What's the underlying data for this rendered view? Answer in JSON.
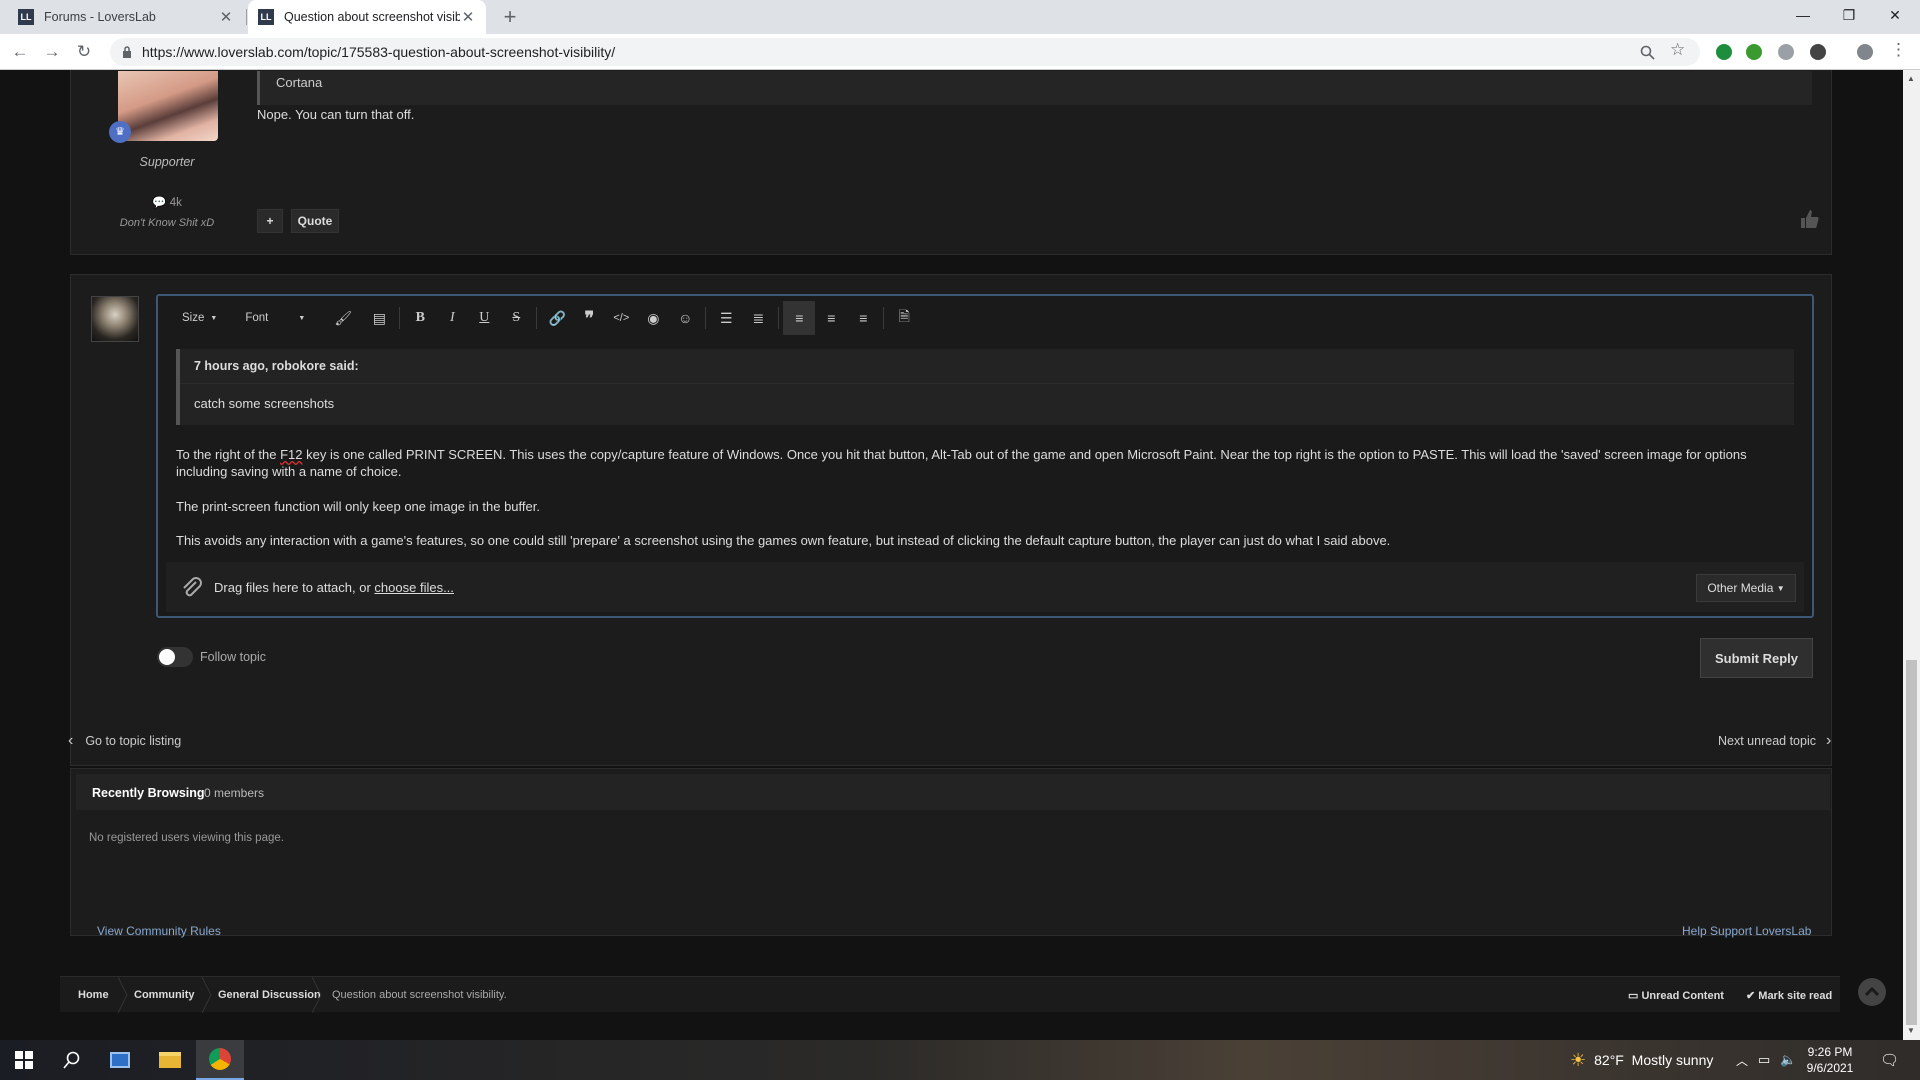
{
  "browser": {
    "tabs": [
      {
        "title": "Forums - LoversLab",
        "favicon": "LL"
      },
      {
        "title": "Question about screenshot visibi",
        "favicon": "LL"
      }
    ],
    "url": "https://www.loverslab.com/topic/175583-question-about-screenshot-visibility/"
  },
  "previous_post": {
    "author_role": "Supporter",
    "author_posts": "4k",
    "author_title": "Don't Know Shit xD",
    "quote_author": "Cortana",
    "text": "Nope. You can turn that off.",
    "quote_button": "Quote",
    "add_button": "+"
  },
  "editor": {
    "toolbar": {
      "size_label": "Size",
      "font_label": "Font"
    },
    "quote_cite": "7 hours ago, robokore said:",
    "quote_text": "catch some screenshots",
    "para1_a": "To the right of the ",
    "para1_b": "F12",
    "para1_c": " key is one called PRINT SCREEN. This uses the copy/capture feature of Windows. Once you hit that button, Alt-Tab out of the game and open Microsoft Paint. Near the top right is the option to PASTE. This will load the 'saved' screen image for options including saving with a name of choice.",
    "para2": "The print-screen function will only keep one image in the buffer.",
    "para3_a": "This avoids any interaction with a game's ",
    "para3_b": "features",
    "para3_c": ", so one could still 'prepare' a screenshot using the games own feature, but instead of clicking the default capture button, the player can just do what I said above.",
    "attach_text": "Drag files here to attach, or ",
    "attach_link": "choose files...",
    "other_media": "Other Media"
  },
  "follow_label": "Follow topic",
  "submit_label": "Submit Reply",
  "nav": {
    "back": "Go to topic listing",
    "next": "Next unread topic"
  },
  "recently_browsing": {
    "title": "Recently Browsing",
    "count": "0 members",
    "empty": "No registered users viewing this page."
  },
  "footer": {
    "rules": "View Community Rules",
    "support": "Help Support LoversLab"
  },
  "breadcrumb": {
    "items": [
      "Home",
      "Community",
      "General Discussion",
      "Question about screenshot visibility."
    ],
    "unread": "Unread Content",
    "mark_read": "Mark site read"
  },
  "taskbar": {
    "weather_temp": "82°F",
    "weather_text": "Mostly sunny",
    "time": "9:26 PM",
    "date": "9/6/2021"
  },
  "colors": {
    "accent_border": "#3e5774",
    "link": "#89a8cf",
    "page_bg": "#121212"
  }
}
